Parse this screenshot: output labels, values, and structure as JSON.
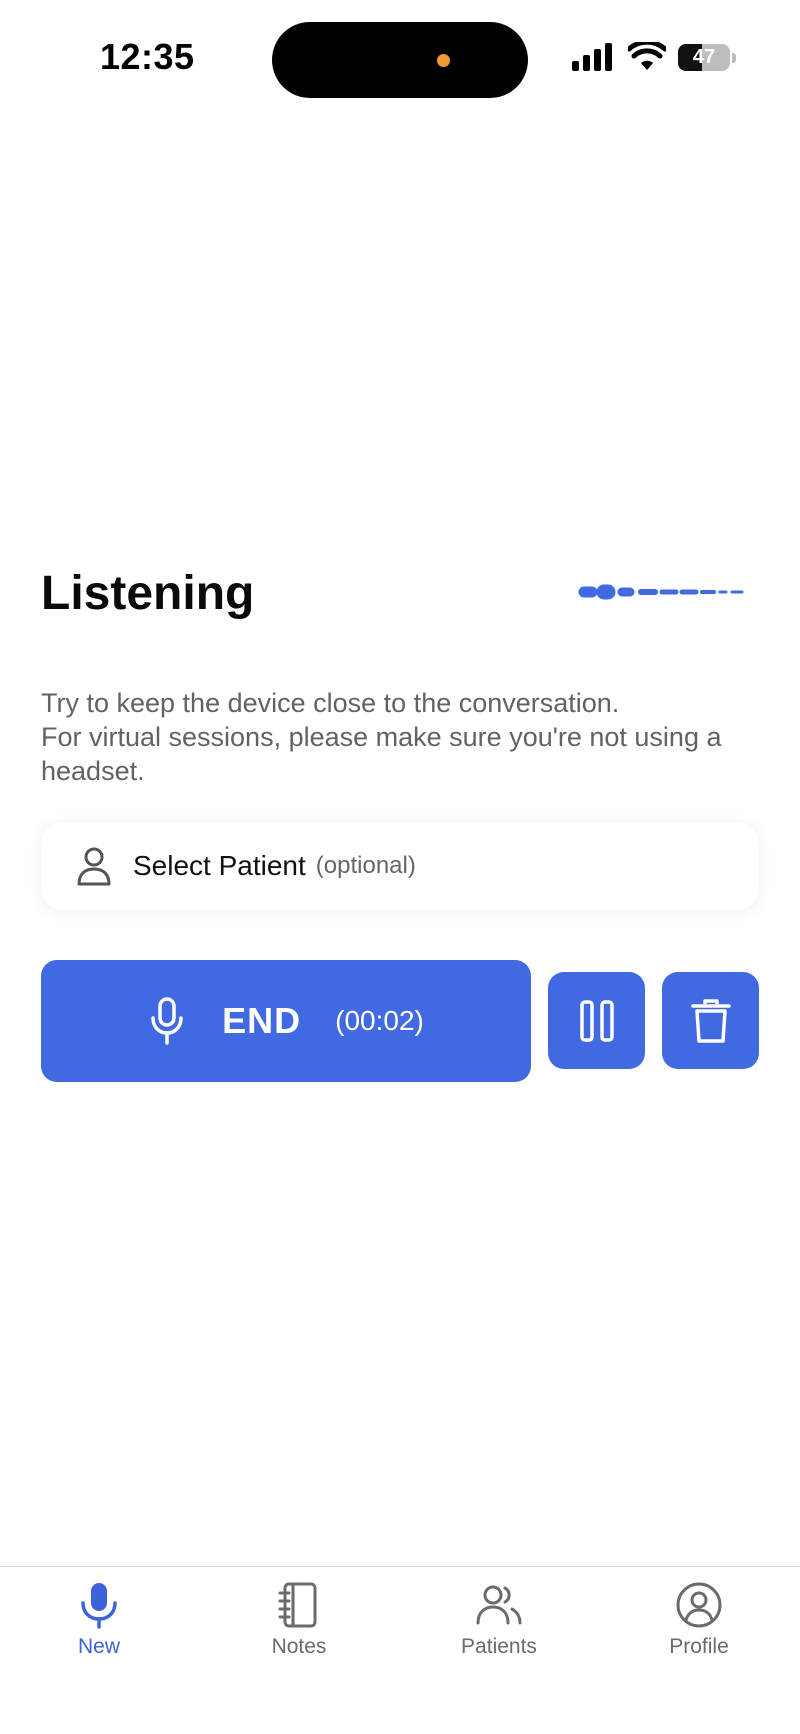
{
  "status_bar": {
    "time": "12:35",
    "battery_level": "47",
    "battery_fraction": 0.47
  },
  "main": {
    "title": "Listening",
    "instructions_line1": "Try to keep the device close to the conversation.",
    "instructions_line2": "For virtual sessions, please make sure you're not using a headset.",
    "patient_select": {
      "label": "Select Patient",
      "optional": "(optional)",
      "icon": "person-icon"
    },
    "recording": {
      "end_label": "END",
      "timer": "(00:02)",
      "mic_icon": "microphone-icon",
      "pause_icon": "pause-icon",
      "delete_icon": "trash-icon"
    }
  },
  "tab_bar": {
    "tabs": [
      {
        "label": "New",
        "icon": "microphone-icon",
        "active": true
      },
      {
        "label": "Notes",
        "icon": "notebook-icon",
        "active": false
      },
      {
        "label": "Patients",
        "icon": "people-icon",
        "active": false
      },
      {
        "label": "Profile",
        "icon": "profile-icon",
        "active": false
      }
    ]
  },
  "colors": {
    "accent": "#4169E1",
    "accent_text": "#3D63DB",
    "muted_text": "#5F6368",
    "recording_indicator": "#F29A38"
  }
}
